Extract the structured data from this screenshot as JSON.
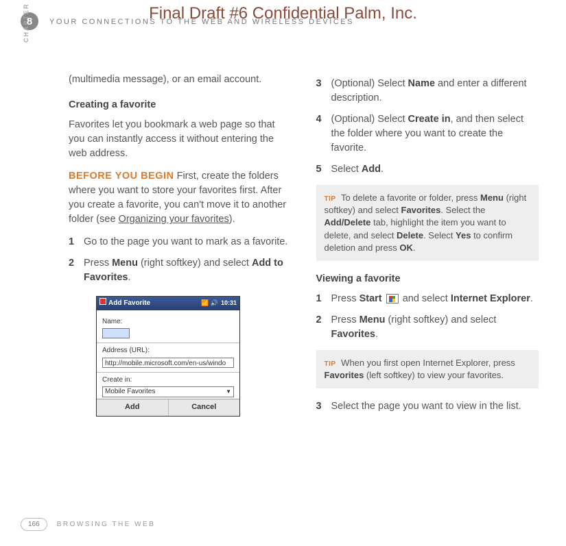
{
  "watermark": "Final Draft #6     Confidential     Palm, Inc.",
  "chapter_number": "8",
  "chapter_banner": "YOUR CONNECTIONS TO THE WEB AND WIRELESS DEVICES",
  "chapter_side": "CHAPTER",
  "left": {
    "intro": "(multimedia message), or an email account.",
    "h1": "Creating a favorite",
    "p1": "Favorites let you bookmark a web page so that you can instantly access it without entering the web address.",
    "byb_label": "BEFORE YOU BEGIN",
    "byb_text": " First, create the folders where you want to store your favorites first. After you create a favorite, you can't move it to another folder (see ",
    "byb_link": "Organizing your favorites",
    "byb_tail": ").",
    "steps": [
      {
        "num": "1",
        "txt": "Go to the page you want to mark as a favorite."
      },
      {
        "num": "2",
        "pre": "Press ",
        "b1": "Menu",
        "mid": " (right softkey) and select ",
        "b2": "Add to Favorites",
        "post": "."
      }
    ]
  },
  "mock": {
    "title": "Add Favorite",
    "time": "10:31",
    "name_lbl": "Name:",
    "name_val": "",
    "addr_lbl": "Address (URL):",
    "addr_val": "http://mobile.microsoft.com/en-us/windo",
    "create_lbl": "Create in:",
    "create_val": "Mobile Favorites",
    "btn_add": "Add",
    "btn_cancel": "Cancel"
  },
  "right": {
    "steps1": [
      {
        "num": "3",
        "pre": "(Optional) Select ",
        "b1": "Name",
        "post": " and enter a different description."
      },
      {
        "num": "4",
        "pre": "(Optional) Select ",
        "b1": "Create in",
        "post": ", and then select the folder where you want to create the favorite."
      },
      {
        "num": "5",
        "pre": "Select ",
        "b1": "Add",
        "post": "."
      }
    ],
    "tip1": {
      "label": "TIP",
      "t1": " To delete a favorite or folder, press ",
      "b1": "Menu",
      "t2": " (right softkey) and select ",
      "b2": "Favorites",
      "t3": ". Select the ",
      "b3": "Add/Delete",
      "t4": " tab, highlight the item you want to delete, and select ",
      "b4": "Delete",
      "t5": ". Select ",
      "b5": "Yes",
      "t6": " to confirm deletion and press ",
      "b6": "OK",
      "t7": "."
    },
    "h2": "Viewing a favorite",
    "steps2": [
      {
        "num": "1",
        "pre": "Press ",
        "b1": "Start",
        "mid": " and select ",
        "b2": "Internet Explorer",
        "post": "."
      },
      {
        "num": "2",
        "pre": "Press ",
        "b1": "Menu",
        "mid": " (right softkey) and select ",
        "b2": "Favorites",
        "post": "."
      }
    ],
    "tip2": {
      "label": "TIP",
      "t1": " When you first open Internet Explorer, press ",
      "b1": "Favorites",
      "t2": " (left softkey) to view your favorites."
    },
    "steps3": [
      {
        "num": "3",
        "txt": "Select the page you want to view in the list."
      }
    ]
  },
  "footer": {
    "page": "166",
    "text": "BROWSING THE WEB"
  }
}
